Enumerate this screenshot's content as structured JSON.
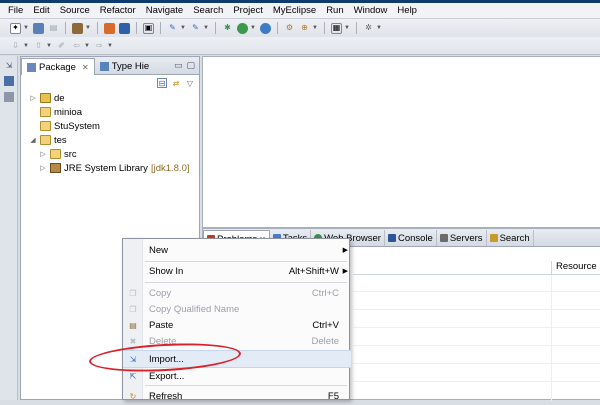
{
  "menubar": {
    "items": [
      "File",
      "Edit",
      "Source",
      "Refactor",
      "Navigate",
      "Search",
      "Project",
      "MyEclipse",
      "Run",
      "Window",
      "Help"
    ]
  },
  "package_view": {
    "tabs": [
      {
        "label": "Package",
        "close": "✕"
      },
      {
        "label": "Type Hie"
      }
    ],
    "tree": [
      {
        "label": "de",
        "twisty": "▷",
        "icon": "project-icon"
      },
      {
        "label": "minioa",
        "twisty": "",
        "icon": "project-icon"
      },
      {
        "label": "StuSystem",
        "twisty": "",
        "icon": "project-icon"
      },
      {
        "label": "tes",
        "twisty": "◢",
        "icon": "project-icon"
      },
      {
        "label": "src",
        "twisty": "▷",
        "icon": "folder-icon",
        "indent": 1
      },
      {
        "label": "JRE System Library",
        "suffix": "[jdk1.8.0]",
        "twisty": "▷",
        "icon": "library-icon",
        "indent": 1
      }
    ]
  },
  "bottom_panel": {
    "tabs": [
      {
        "label": "Problems",
        "close": "✕",
        "active": true,
        "color": "#c23a2b"
      },
      {
        "label": "Tasks",
        "color": "#4a7bc8"
      },
      {
        "label": "Web Browser",
        "color": "#3a8f4b"
      },
      {
        "label": "Console",
        "color": "#2f5597"
      },
      {
        "label": "Servers",
        "color": "#6b6b6b"
      },
      {
        "label": "Search",
        "color": "#c79a2a"
      }
    ],
    "column_resource": "Resource"
  },
  "context_menu": {
    "items": [
      {
        "label": "New",
        "shortcut": "",
        "submenu": true,
        "disabled": false
      },
      {
        "label": "Show In",
        "shortcut": "Alt+Shift+W",
        "submenu": true,
        "disabled": false
      },
      {
        "label": "Copy",
        "shortcut": "Ctrl+C",
        "submenu": false,
        "disabled": true
      },
      {
        "label": "Copy Qualified Name",
        "shortcut": "",
        "submenu": false,
        "disabled": true
      },
      {
        "label": "Paste",
        "shortcut": "Ctrl+V",
        "submenu": false,
        "disabled": false
      },
      {
        "label": "Delete",
        "shortcut": "Delete",
        "submenu": false,
        "disabled": true
      },
      {
        "label": "Import...",
        "shortcut": "",
        "submenu": false,
        "disabled": false,
        "highlighted": true
      },
      {
        "label": "Export...",
        "shortcut": "",
        "submenu": false,
        "disabled": false
      },
      {
        "label": "Refresh",
        "shortcut": "F5",
        "submenu": false,
        "disabled": false
      }
    ]
  },
  "colors": {
    "annotation": "#d9232a",
    "title_strip": "#0f3b6e"
  }
}
